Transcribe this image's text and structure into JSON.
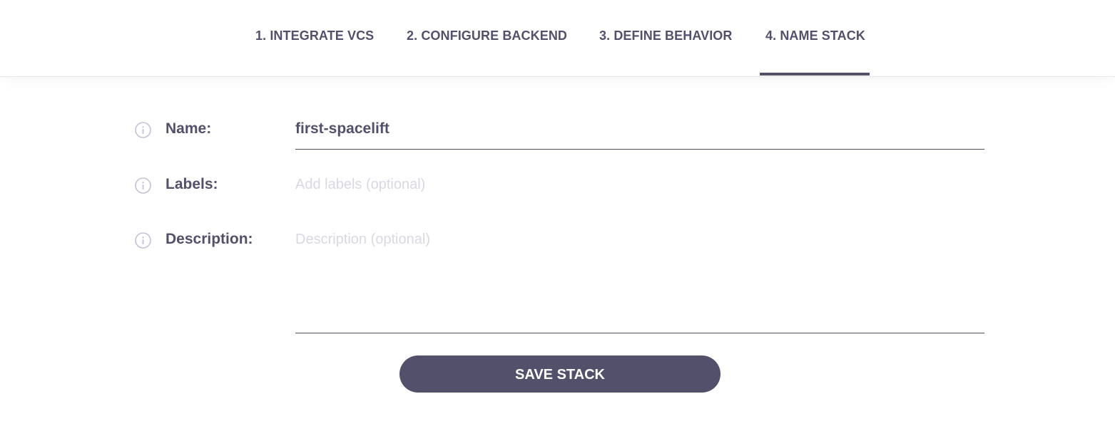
{
  "steps": [
    {
      "label": "1. INTEGRATE VCS"
    },
    {
      "label": "2. CONFIGURE BACKEND"
    },
    {
      "label": "3. DEFINE BEHAVIOR"
    },
    {
      "label": "4. NAME STACK",
      "active": true
    }
  ],
  "form": {
    "name": {
      "label": "Name:",
      "value": "first-spacelift"
    },
    "labels": {
      "label": "Labels:",
      "placeholder": "Add labels (optional)"
    },
    "description": {
      "label": "Description:",
      "placeholder": "Description (optional)"
    }
  },
  "save_button": "SAVE STACK",
  "icons": {
    "info": "info-circle-icon"
  },
  "colors": {
    "text": "#52506a",
    "placeholder": "#d9d7e2",
    "button_bg": "#52506a",
    "button_text": "#ffffff"
  }
}
